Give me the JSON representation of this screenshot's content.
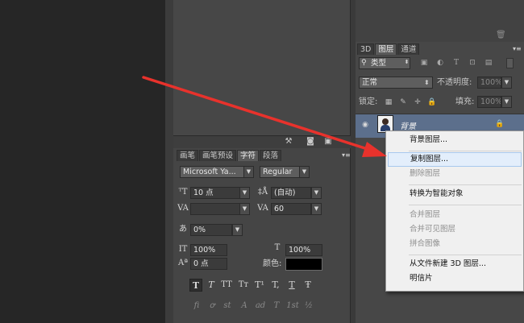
{
  "character_panel": {
    "tabs": [
      "画笔",
      "画笔预设",
      "字符",
      "段落"
    ],
    "active_tab": 2,
    "font_family": "Microsoft Ya...",
    "font_style": "Regular",
    "font_size": "10 点",
    "leading": "(自动)",
    "kerning": "",
    "tracking": "60",
    "tsume": "0%",
    "vertical_scale": "100%",
    "horizontal_scale": "100%",
    "baseline_shift": "0 点",
    "color_label": "颜色:",
    "color_swatch": "#000000",
    "type_styles": [
      "T",
      "T",
      "TT",
      "Tт",
      "T¹",
      "T,",
      "T",
      "Ŧ"
    ],
    "opentype": [
      "fi",
      "ꝍ",
      "st",
      "A",
      "ad",
      "T",
      "1st",
      "½"
    ]
  },
  "layers_panel": {
    "tabs": [
      "3D",
      "图层",
      "通道"
    ],
    "active_tab": 1,
    "filter_kind": "类型",
    "blend_mode": "正常",
    "opacity_label": "不透明度:",
    "opacity_value": "100%",
    "lock_label": "锁定:",
    "fill_label": "填充:",
    "fill_value": "100%",
    "layer_name": "背景"
  },
  "context_menu": {
    "items": [
      {
        "label": "背景图层...",
        "enabled": true
      },
      {
        "label": "复制图层...",
        "enabled": true,
        "highlighted": true
      },
      {
        "label": "删除图层",
        "enabled": false
      },
      {
        "label": "转换为智能对象",
        "enabled": true
      },
      {
        "label": "合并图层",
        "enabled": false
      },
      {
        "label": "合并可见图层",
        "enabled": false
      },
      {
        "label": "拼合图像",
        "enabled": false
      },
      {
        "label": "从文件新建 3D 图层...",
        "enabled": true
      },
      {
        "label": "明信片",
        "enabled": true
      }
    ]
  },
  "colors": {
    "accent_arrow": "#e8322c",
    "layer_selected": "#5c6f8c",
    "menu_highlight": "#e3eefb"
  }
}
